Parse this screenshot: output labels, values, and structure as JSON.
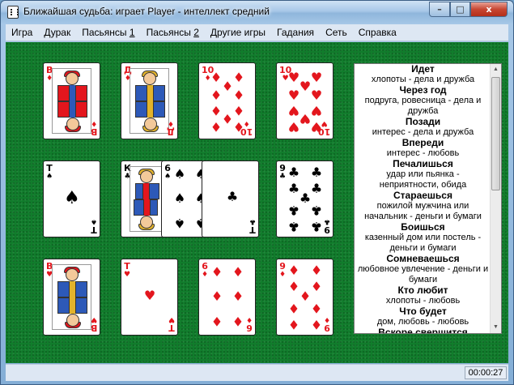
{
  "window": {
    "title": "Ближайшая судьба: играет Player - интеллект средний",
    "buttons": {
      "minimize": "–",
      "maximize": "□",
      "close": "x"
    }
  },
  "menu": [
    {
      "label": "Игра"
    },
    {
      "label": "Дурак"
    },
    {
      "label": "Пасьянсы",
      "num": "1"
    },
    {
      "label": "Пасьянсы",
      "num": "2"
    },
    {
      "label": "Другие игры"
    },
    {
      "label": "Гадания"
    },
    {
      "label": "Сеть"
    },
    {
      "label": "Справка"
    }
  ],
  "cards": {
    "r1c1": {
      "rank": "В",
      "suit": "♦",
      "color": "#e3161d",
      "icon": "jack-of-diamonds"
    },
    "r1c2": {
      "rank": "Д",
      "suit": "♦",
      "color": "#e3161d",
      "icon": "queen-of-diamonds"
    },
    "r1c3": {
      "rank": "10",
      "suit": "♦",
      "color": "#e3161d"
    },
    "r1c4": {
      "rank": "10",
      "suit": "♥",
      "color": "#e3161d"
    },
    "r2c1": {
      "rank": "Т",
      "suit": "♠",
      "color": "#000000"
    },
    "r2c2": {
      "rank": "К",
      "suit": "♣",
      "color": "#000000",
      "icon": "king-of-clubs"
    },
    "r2c2b": {
      "rank": "6",
      "suit": "♠",
      "color": "#000000"
    },
    "r2c2c": {
      "rank": "Т",
      "suit": "♣",
      "color": "#000000"
    },
    "r2c4": {
      "rank": "9",
      "suit": "♣",
      "color": "#000000"
    },
    "r3c1": {
      "rank": "В",
      "suit": "♥",
      "color": "#e3161d",
      "icon": "jack-of-hearts"
    },
    "r3c2": {
      "rank": "Т",
      "suit": "♥",
      "color": "#e3161d"
    },
    "r3c3": {
      "rank": "6",
      "suit": "♦",
      "color": "#e3161d"
    },
    "r3c4": {
      "rank": "9",
      "suit": "♦",
      "color": "#e3161d"
    }
  },
  "reading": [
    {
      "heading": "Идет",
      "text": "хлопоты - дела и дружба"
    },
    {
      "heading": "Через год",
      "text": "подруга, ровесница - дела и дружба"
    },
    {
      "heading": "Позади",
      "text": "интерес - дела и дружба"
    },
    {
      "heading": "Впереди",
      "text": "интерес - любовь"
    },
    {
      "heading": "Печалишься",
      "text": "удар или пьянка - неприятности, обида"
    },
    {
      "heading": "Стараешься",
      "text": "пожилой мужчина или начальник - деньги и бумаги"
    },
    {
      "heading": "Боишься",
      "text": "казенный дом или постель - деньги и бумаги"
    },
    {
      "heading": "Сомневаешься",
      "text": "любовное увлечение - деньги и бумаги"
    },
    {
      "heading": "Кто любит",
      "text": "хлопоты - любовь"
    },
    {
      "heading": "Что будет",
      "text": "дом, любовь - любовь"
    },
    {
      "heading": "Вскоре свершится",
      "text": ""
    }
  ],
  "status": {
    "timer": "00:00:27"
  }
}
